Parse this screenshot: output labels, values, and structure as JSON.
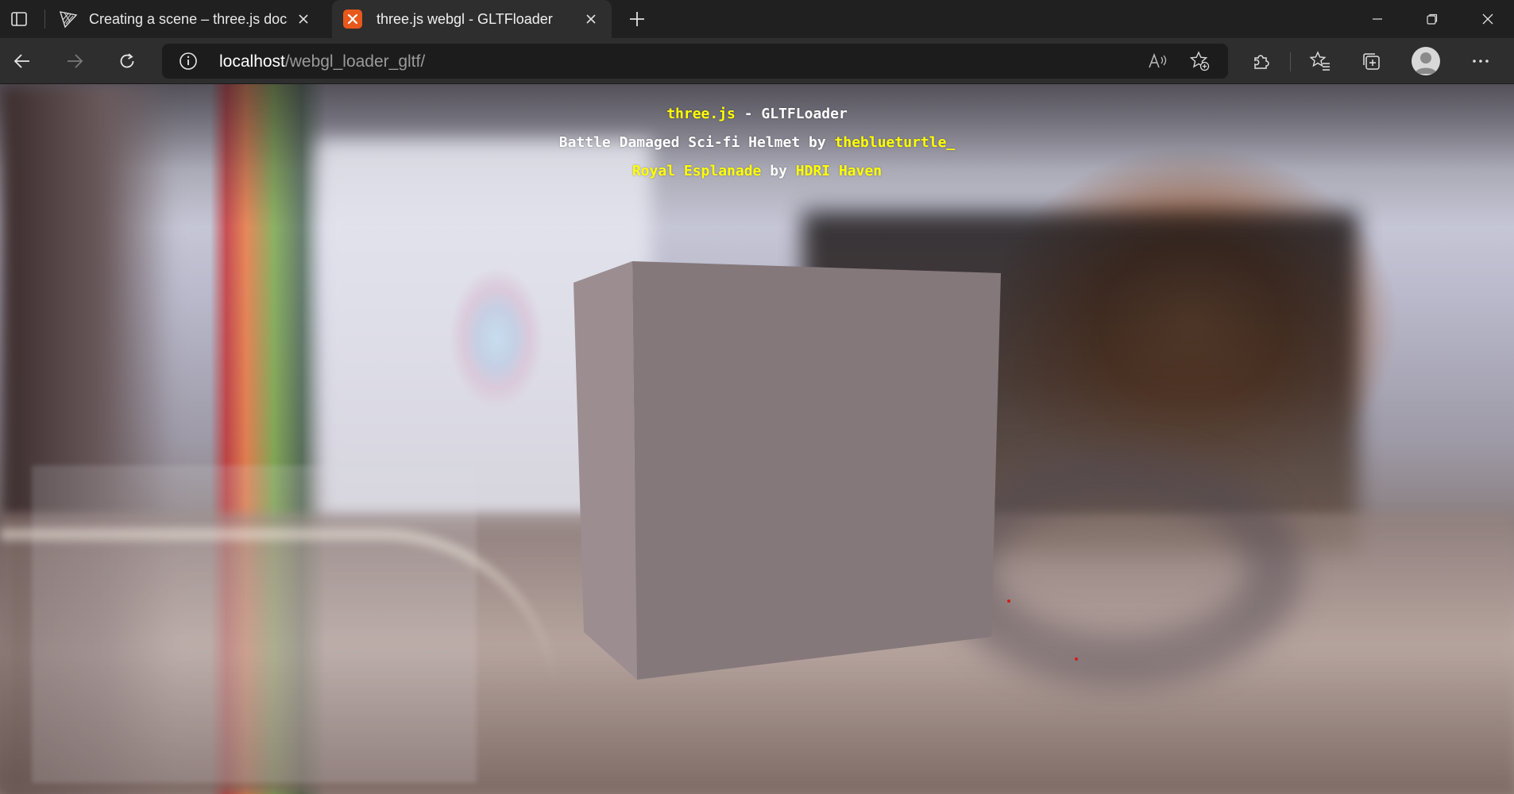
{
  "browser": {
    "tabs": [
      {
        "title": "Creating a scene – three.js docs",
        "icon": "threejs-logo-icon",
        "active": false
      },
      {
        "title": "three.js webgl - GLTFloader",
        "icon": "xampp-icon",
        "active": true
      }
    ],
    "address": {
      "host": "localhost",
      "path": "/webgl_loader_gltf/"
    }
  },
  "page": {
    "line1": {
      "link": "three.js",
      "text": " - GLTFLoader"
    },
    "line2": {
      "text": "Battle Damaged Sci-fi Helmet by ",
      "link": "theblueturtle_"
    },
    "line3": {
      "link1": "Royal Esplanade",
      "mid": " by ",
      "link2": "HDRI Haven"
    }
  },
  "colors": {
    "link": "#ffff00",
    "cube_front": "#85787a",
    "cube_side": "#9b8d90",
    "cube_top": "#a99ca0"
  }
}
